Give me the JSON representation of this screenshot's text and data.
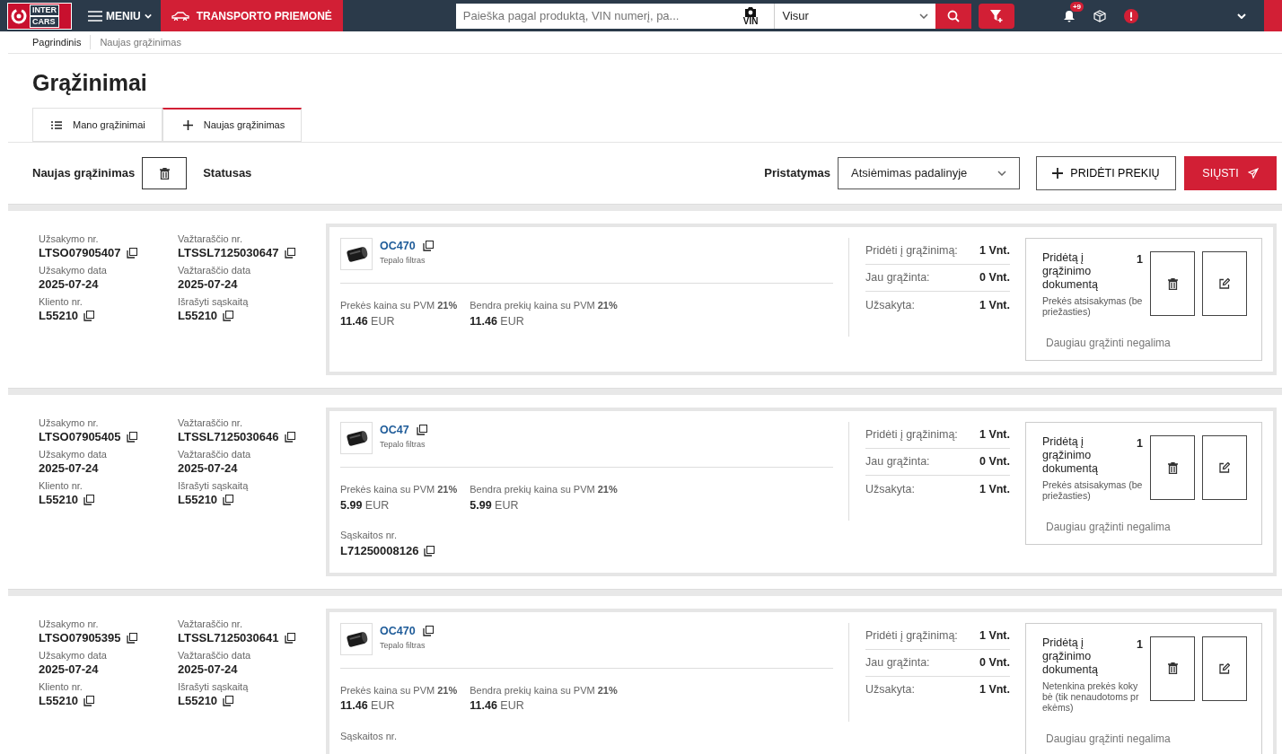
{
  "topbar": {
    "logo": [
      "INTER",
      "CARS"
    ],
    "menu": "MENIU",
    "vehicle": "TRANSPORTO PRIEMONĖ",
    "search": {
      "placeholder": "Paieška pagal produktą, VIN numerį, pa..."
    },
    "vin": "VIN",
    "scope": "Visur",
    "notifications": "+9"
  },
  "breadcrumb": [
    {
      "label": "Pagrindinis",
      "selected": false
    },
    {
      "label": "Naujas grąžinimas",
      "selected": true
    }
  ],
  "title": "Grąžinimai",
  "tabs": [
    {
      "label": "Mano grąžinimai",
      "kind": "list",
      "selected": false
    },
    {
      "label": "Naujas grąžinimas",
      "kind": "plus",
      "selected": true
    }
  ],
  "toolbar": {
    "name": "Naujas grąžinimas",
    "status": "Statusas",
    "delivery_label": "Pristatymas",
    "delivery": "Atsiėmimas padalinyje",
    "add": "PRIDĖTI PREKIŲ",
    "send": "SIŲSTI"
  },
  "rows": [
    {
      "fields": [
        {
          "label": "Užsakymo nr.",
          "value": "LTSO07905407",
          "kind": "copy"
        },
        {
          "label": "Važtaraščio nr.",
          "value": "LTSSL7125030647",
          "kind": "copy"
        },
        {
          "label": "Užsakymo data",
          "value": "2025-07-24",
          "kind": "plain"
        },
        {
          "label": "Važtaraščio data",
          "value": "2025-07-24",
          "kind": "plain"
        },
        {
          "label": "Kliento nr.",
          "value": "L55210",
          "kind": "copy"
        },
        {
          "label": "Išrašyti sąskaitą",
          "value": "L55210",
          "kind": "copy"
        }
      ],
      "product": {
        "code": "OC470",
        "name": "Tepalo filtras",
        "prices": [
          {
            "label": "Prekės kaina su PVM",
            "vat": "21%",
            "amount": "11.46",
            "currency": "EUR"
          },
          {
            "label": "Bendra prekių kaina su PVM",
            "vat": "21%",
            "amount": "11.46",
            "currency": "EUR"
          }
        ]
      },
      "quantities": [
        {
          "label": "Pridėti į grąžinimą:",
          "value": "1 Vnt."
        },
        {
          "label": "Jau grąžinta:",
          "value": "0 Vnt."
        },
        {
          "label": "Užsakyta:",
          "value": "1 Vnt."
        }
      ],
      "returned": {
        "title": "Pridėtą į grąžinimo dokumentą",
        "count": "1",
        "reason": "Prekės atsisakymas (be priežasties)",
        "note": "Daugiau grąžinti negalima"
      }
    },
    {
      "fields": [
        {
          "label": "Užsakymo nr.",
          "value": "LTSO07905405",
          "kind": "copy"
        },
        {
          "label": "Važtaraščio nr.",
          "value": "LTSSL7125030646",
          "kind": "copy"
        },
        {
          "label": "Užsakymo data",
          "value": "2025-07-24",
          "kind": "plain"
        },
        {
          "label": "Važtaraščio data",
          "value": "2025-07-24",
          "kind": "plain"
        },
        {
          "label": "Kliento nr.",
          "value": "L55210",
          "kind": "copy"
        },
        {
          "label": "Išrašyti sąskaitą",
          "value": "L55210",
          "kind": "copy"
        }
      ],
      "product": {
        "code": "OC47",
        "name": "Tepalo filtras",
        "prices": [
          {
            "label": "Prekės kaina su PVM",
            "vat": "21%",
            "amount": "5.99",
            "currency": "EUR"
          },
          {
            "label": "Bendra prekių kaina su PVM",
            "vat": "21%",
            "amount": "5.99",
            "currency": "EUR"
          }
        ],
        "invoice_label": "Sąskaitos nr.",
        "invoice": "L71250008126"
      },
      "quantities": [
        {
          "label": "Pridėti į grąžinimą:",
          "value": "1 Vnt."
        },
        {
          "label": "Jau grąžinta:",
          "value": "0 Vnt."
        },
        {
          "label": "Užsakyta:",
          "value": "1 Vnt."
        }
      ],
      "returned": {
        "title": "Pridėtą į grąžinimo dokumentą",
        "count": "1",
        "reason": "Prekės atsisakymas (be priežasties)",
        "note": "Daugiau grąžinti negalima"
      }
    },
    {
      "fields": [
        {
          "label": "Užsakymo nr.",
          "value": "LTSO07905395",
          "kind": "copy"
        },
        {
          "label": "Važtaraščio nr.",
          "value": "LTSSL7125030641",
          "kind": "copy"
        },
        {
          "label": "Užsakymo data",
          "value": "2025-07-24",
          "kind": "plain"
        },
        {
          "label": "Važtaraščio data",
          "value": "2025-07-24",
          "kind": "plain"
        },
        {
          "label": "Kliento nr.",
          "value": "L55210",
          "kind": "copy"
        },
        {
          "label": "Išrašyti sąskaitą",
          "value": "L55210",
          "kind": "copy"
        }
      ],
      "product": {
        "code": "OC470",
        "name": "Tepalo filtras",
        "prices": [
          {
            "label": "Prekės kaina su PVM",
            "vat": "21%",
            "amount": "11.46",
            "currency": "EUR"
          },
          {
            "label": "Bendra prekių kaina su PVM",
            "vat": "21%",
            "amount": "11.46",
            "currency": "EUR"
          }
        ],
        "invoice_label": "Sąskaitos nr."
      },
      "quantities": [
        {
          "label": "Pridėti į grąžinimą:",
          "value": "1 Vnt."
        },
        {
          "label": "Jau grąžinta:",
          "value": "0 Vnt."
        },
        {
          "label": "Užsakyta:",
          "value": "1 Vnt."
        }
      ],
      "returned": {
        "title": "Pridėtą į grąžinimo dokumentą",
        "count": "1",
        "reason": "Netenkina prekės kokybė (tik nenaudotoms prekėms)",
        "note": "Daugiau grąžinti negalima"
      }
    }
  ]
}
